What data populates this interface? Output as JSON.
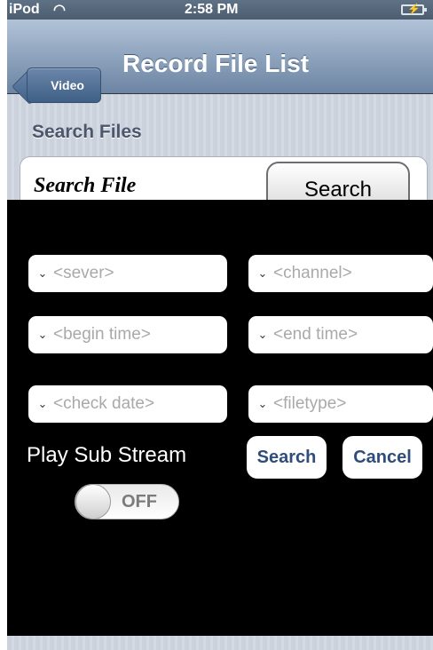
{
  "status_bar": {
    "carrier": "iPod",
    "time": "2:58 PM"
  },
  "nav": {
    "back_label": "Video",
    "title": "Record File List"
  },
  "section": {
    "header": "Search Files",
    "cell_label": "Search File",
    "cell_button": "Search"
  },
  "filters": {
    "server": "<sever>",
    "channel": "<channel>",
    "begin_time": "<begin time>",
    "end_time": "<end time>",
    "check_date": "<check date>",
    "filetype": "<filetype>"
  },
  "sub_stream": {
    "label": "Play Sub Stream",
    "toggle_text": "OFF",
    "is_on": false
  },
  "actions": {
    "search": "Search",
    "cancel": "Cancel"
  },
  "icons": {
    "wifi": "wifi-icon",
    "battery": "battery-charging-icon",
    "dropdown": "chevron-down-icon"
  },
  "colors": {
    "nav_accent": "#6c85a3",
    "action_text": "#2f4d7a",
    "overlay": "#000000"
  }
}
